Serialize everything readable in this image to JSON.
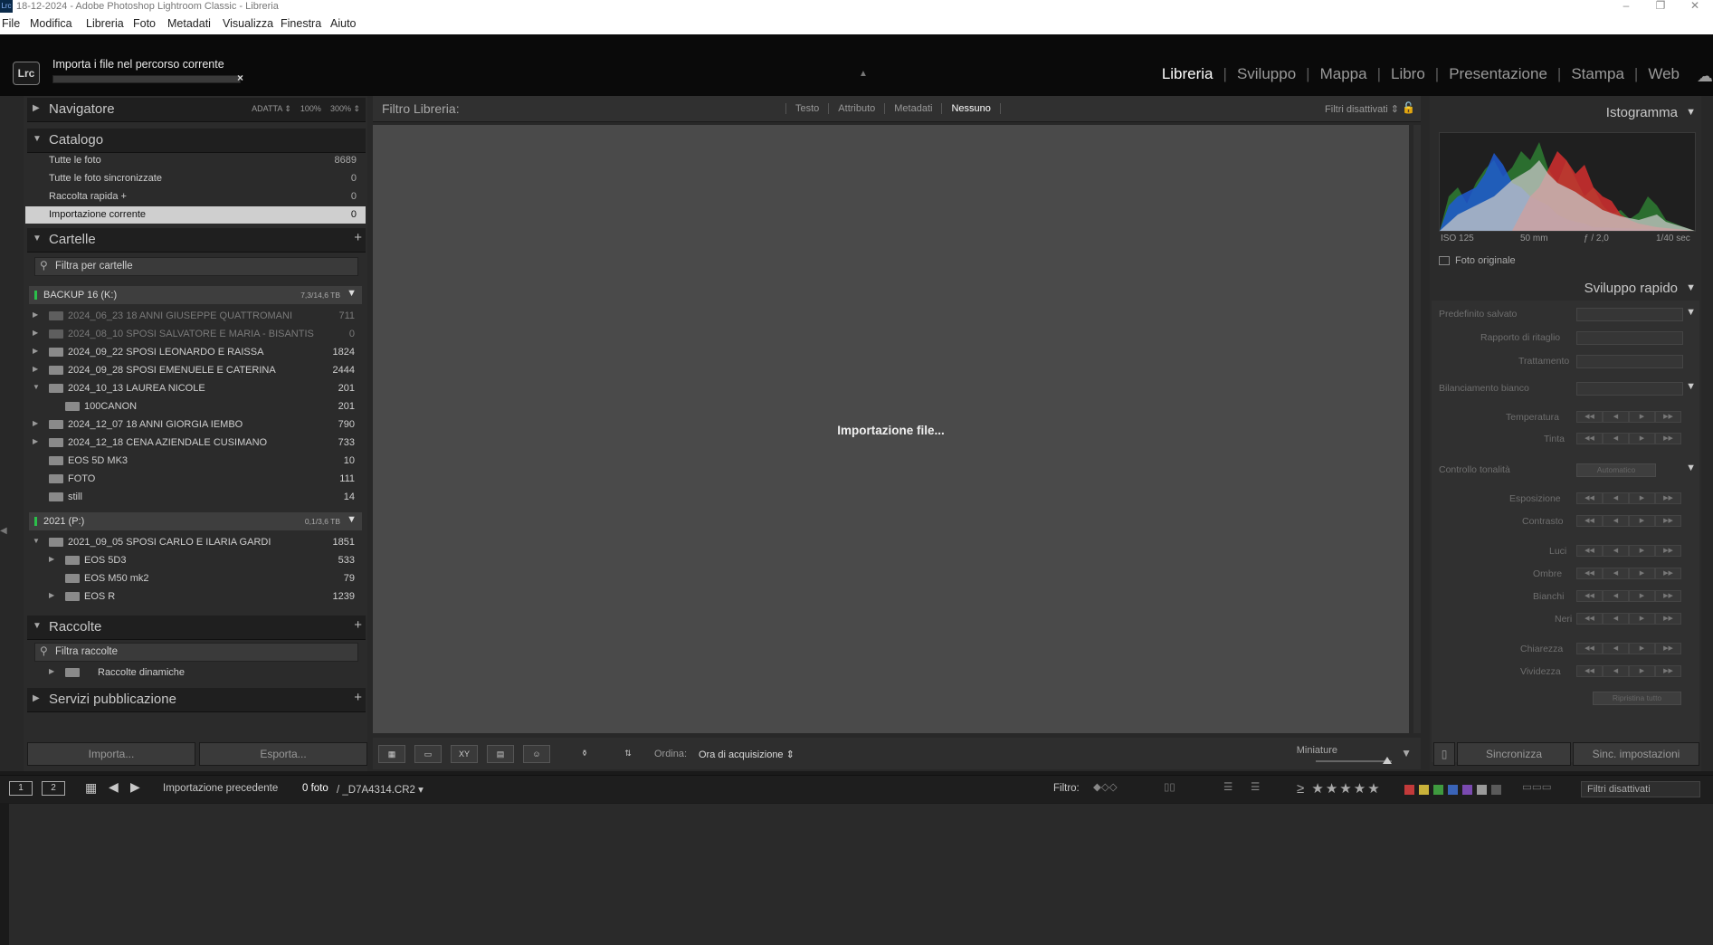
{
  "window": {
    "title": "18-12-2024 - Adobe Photoshop Lightroom Classic - Libreria",
    "badge": "Lrc",
    "controls": {
      "minimize": "–",
      "maximize": "❐",
      "close": "✕"
    }
  },
  "menu": [
    "File",
    "Modifica",
    "Libreria",
    "Foto",
    "Metadati",
    "Visualizza",
    "Finestra",
    "Aiuto"
  ],
  "topbar": {
    "logo": "Lrc",
    "import_status": "Importa i file nel percorso corrente",
    "progress_close": "×",
    "modules": [
      {
        "label": "Libreria",
        "active": true
      },
      {
        "label": "Sviluppo",
        "active": false
      },
      {
        "label": "Mappa",
        "active": false
      },
      {
        "label": "Libro",
        "active": false
      },
      {
        "label": "Presentazione",
        "active": false
      },
      {
        "label": "Stampa",
        "active": false
      },
      {
        "label": "Web",
        "active": false
      }
    ],
    "cloud_icon": "cloud-icon"
  },
  "left": {
    "navigator": {
      "title": "Navigatore",
      "opt1": "ADATTA ⇕",
      "opt2": "100%",
      "opt3": "300% ⇕"
    },
    "catalog": {
      "title": "Catalogo",
      "items": [
        {
          "label": "Tutte le foto",
          "count": "8689"
        },
        {
          "label": "Tutte le foto sincronizzate",
          "count": "0"
        },
        {
          "label": "Raccolta rapida +",
          "count": "0"
        },
        {
          "label": "Importazione corrente",
          "count": "0"
        }
      ]
    },
    "folders": {
      "title": "Cartelle",
      "filter": "Filtra per cartelle",
      "vol1": {
        "name": "BACKUP 16 (K:)",
        "capacity": "7,3/14,6 TB"
      },
      "vol1_items": [
        {
          "name": "2024_06_23 18 ANNI GIUSEPPE QUATTROMANI",
          "count": "711"
        },
        {
          "name": "2024_08_10 SPOSI SALVATORE E MARIA - BISANTIS",
          "count": "0"
        },
        {
          "name": "2024_09_22 SPOSI LEONARDO E RAISSA",
          "count": "1824"
        },
        {
          "name": "2024_09_28 SPOSI EMENUELE E CATERINA",
          "count": "2444"
        },
        {
          "name": "2024_10_13 LAUREA NICOLE",
          "count": "201"
        },
        {
          "name": "100CANON",
          "count": "201"
        },
        {
          "name": "2024_12_07 18 ANNI GIORGIA IEMBO",
          "count": "790"
        },
        {
          "name": "2024_12_18 CENA AZIENDALE CUSIMANO",
          "count": "733"
        },
        {
          "name": "EOS 5D MK3",
          "count": "10"
        },
        {
          "name": "FOTO",
          "count": "111"
        },
        {
          "name": "still",
          "count": "14"
        }
      ],
      "vol2": {
        "name": "2021 (P:)",
        "capacity": "0,1/3,6 TB"
      },
      "vol2_items": [
        {
          "name": "2021_09_05 SPOSI CARLO E ILARIA GARDI",
          "count": "1851"
        },
        {
          "name": "EOS 5D3",
          "count": "533"
        },
        {
          "name": "EOS M50 mk2",
          "count": "79"
        },
        {
          "name": "EOS R",
          "count": "1239"
        }
      ]
    },
    "collections": {
      "title": "Raccolte",
      "filter": "Filtra raccolte",
      "smart": "Raccolte dinamiche"
    },
    "publish": {
      "title": "Servizi pubblicazione"
    },
    "import_btn": "Importa...",
    "export_btn": "Esporta..."
  },
  "center": {
    "filter_label": "Filtro Libreria:",
    "filter_options": [
      {
        "label": "Testo",
        "active": false
      },
      {
        "label": "Attributo",
        "active": false
      },
      {
        "label": "Metadati",
        "active": false
      },
      {
        "label": "Nessuno",
        "active": true
      }
    ],
    "filters_off": "Filtri disattivati ⇕",
    "message": "Importazione file...",
    "toolbar": {
      "sort_label": "Ordina:",
      "sort_value": "Ora di acquisizione ⇕",
      "thumbs_label": "Miniature",
      "thumb_size": 1.0
    }
  },
  "right": {
    "histogram": {
      "title": "Istogramma",
      "iso": "ISO 125",
      "focal": "50 mm",
      "aperture": "ƒ / 2,0",
      "shutter": "1/40 sec",
      "original": "Foto originale"
    },
    "quick_develop": {
      "title": "Sviluppo rapido",
      "preset": "Predefinito salvato",
      "crop": "Rapporto di ritaglio",
      "treatment": "Trattamento",
      "wb": "Bilanciamento bianco",
      "temp": "Temperatura",
      "tint": "Tinta",
      "tone": "Controllo tonalità",
      "auto": "Automatico",
      "exposure": "Esposizione",
      "contrast": "Contrasto",
      "highlights": "Luci",
      "shadows": "Ombre",
      "whites": "Bianchi",
      "blacks": "Neri",
      "clarity": "Chiarezza",
      "vibrance": "Vividezza",
      "reset": "Ripristina tutto"
    },
    "sync_btn": "Sincronizza",
    "sync_settings_btn": "Sinc. impostazioni"
  },
  "filmstrip": {
    "page1": "1",
    "page2": "2",
    "source": "Importazione precedente",
    "count": "0 foto",
    "path": "/ _D7A4314.CR2 ▾",
    "filter_label": "Filtro:",
    "stars": "≥ ★★★★★",
    "filter_dropdown": "Filtri disattivati",
    "colors": [
      "#c23a3a",
      "#c9b23a",
      "#3f9a3f",
      "#3a64b8",
      "#7a4ab0",
      "#9a9a9a",
      "#5a5a5a"
    ]
  }
}
